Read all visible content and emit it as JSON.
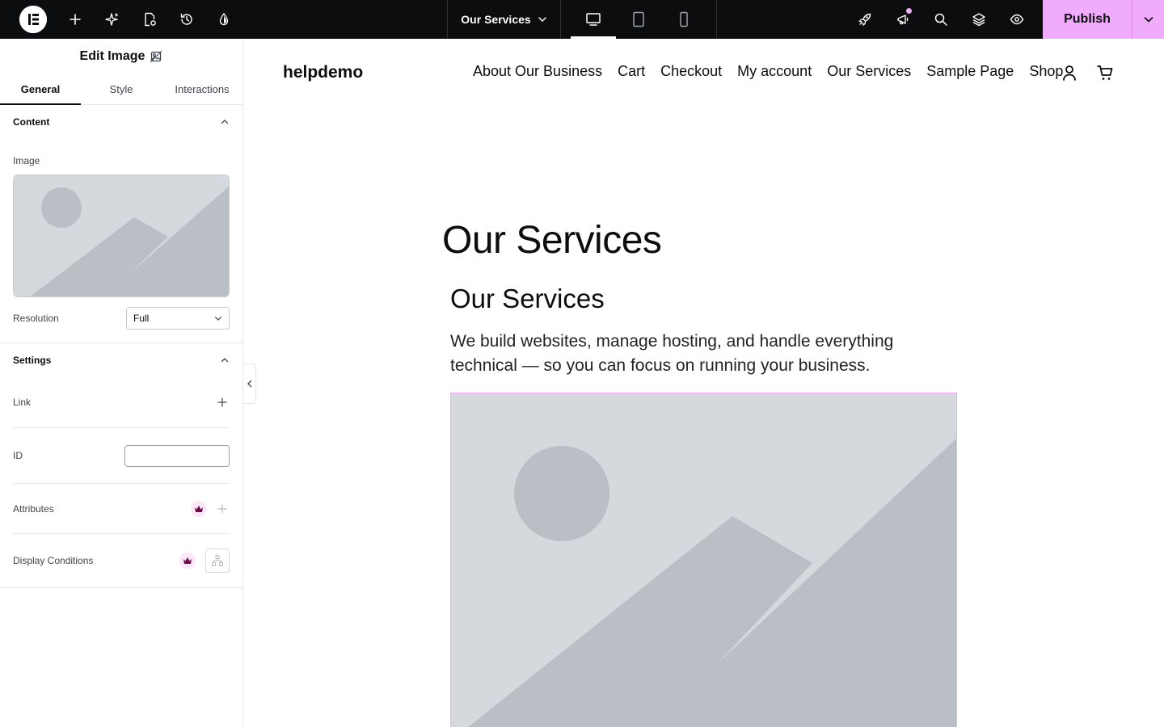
{
  "topbar": {
    "page_selector_label": "Our Services",
    "publish_label": "Publish",
    "left_tools": [
      "add-element",
      "ai-tools",
      "page-settings",
      "history",
      "site-style"
    ],
    "devices": [
      "desktop",
      "tablet",
      "mobile"
    ],
    "active_device": "desktop",
    "right_tools": [
      "launch",
      "notifications",
      "search",
      "structure",
      "preview"
    ],
    "accent_color": "#f0abfc",
    "bar_color": "#0c0d0e"
  },
  "panel": {
    "title": "Edit Image",
    "tabs": [
      "General",
      "Style",
      "Interactions"
    ],
    "active_tab": "General",
    "content_section": "Content",
    "image_label": "Image",
    "resolution_label": "Resolution",
    "resolution_value": "Full",
    "settings_section": "Settings",
    "link_label": "Link",
    "id_label": "ID",
    "id_value": "",
    "attributes_label": "Attributes",
    "display_conditions_label": "Display Conditions"
  },
  "site": {
    "title": "helpdemo",
    "nav": [
      "About Our Business",
      "Cart",
      "Checkout",
      "My account",
      "Our Services",
      "Sample Page",
      "Shop"
    ],
    "page_heading": "Our Services",
    "section_heading": "Our Services",
    "intro": "We build websites, manage hosting, and handle everything technical — so you can focus on running your business."
  }
}
